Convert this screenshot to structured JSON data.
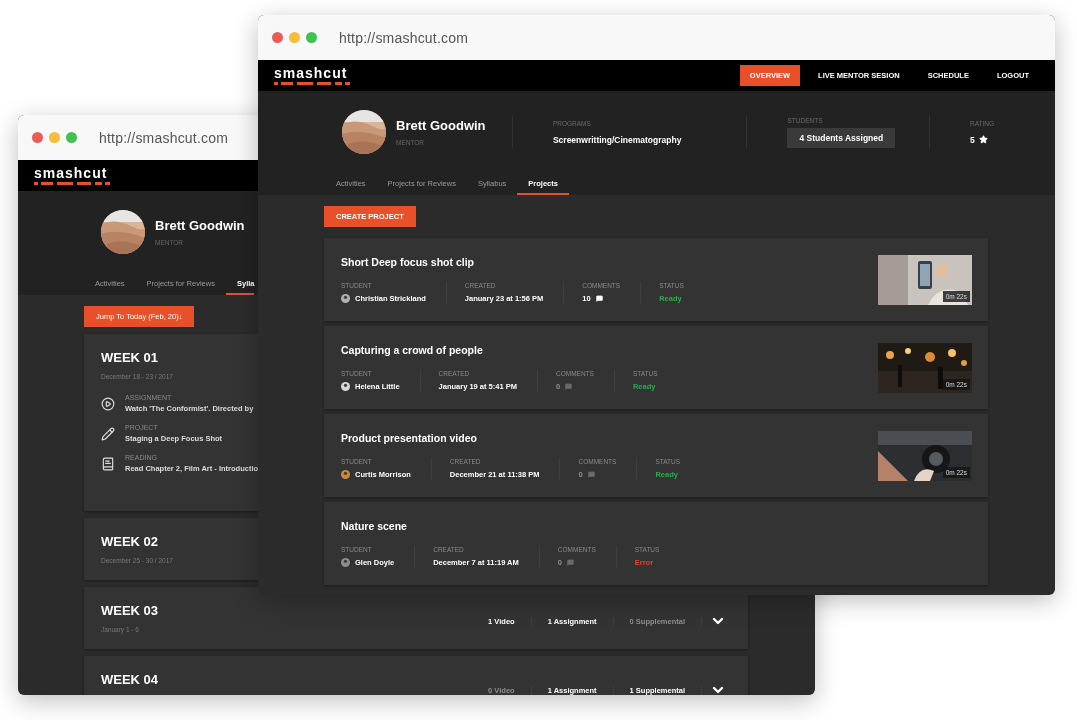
{
  "back_window": {
    "url": "http://smashcut.com",
    "logo": "smashcut",
    "profile": {
      "name": "Brett Goodwin",
      "role": "MENTOR"
    },
    "tabs": [
      {
        "label": "Activities",
        "selected": false
      },
      {
        "label": "Projects for Reviews",
        "selected": false
      },
      {
        "label": "Sylla",
        "selected": true
      }
    ],
    "jump_button": "Jump To Today (Feb, 20)↓",
    "weeks": [
      {
        "title": "WEEK 01",
        "dates": "December 18 - 23 / 2017",
        "items": [
          {
            "kind": "assignment",
            "label": "ASSIGNMENT",
            "text": "Watch 'The Conformist'. Directed by"
          },
          {
            "kind": "project",
            "label": "PROJECT",
            "text": "Staging a Deep Focus Shot"
          },
          {
            "kind": "reading",
            "label": "READING",
            "text": "Read Chapter 2, Film Art - Introductio"
          }
        ]
      },
      {
        "title": "WEEK 02",
        "dates": "December 25 - 30 / 2017"
      },
      {
        "title": "WEEK 03",
        "dates": "January 1 - 6",
        "counts": [
          {
            "text": "1 Video",
            "dimmed": false
          },
          {
            "text": "1 Assignment",
            "dimmed": false
          },
          {
            "text": "0 Supplemental",
            "dimmed": true
          }
        ]
      },
      {
        "title": "WEEK 04",
        "counts": [
          {
            "text": "0 Video",
            "dimmed": true
          },
          {
            "text": "1 Assignment",
            "dimmed": false
          },
          {
            "text": "1 Supplemental",
            "dimmed": false
          }
        ]
      }
    ]
  },
  "front_window": {
    "url": "http://smashcut.com",
    "logo": "smashcut",
    "nav": [
      {
        "label": "OVERVIEW",
        "selected": true
      },
      {
        "label": "LIVE MENTOR SESION",
        "selected": false
      },
      {
        "label": "SCHEDULE",
        "selected": false
      },
      {
        "label": "LOGOUT",
        "selected": false
      }
    ],
    "profile": {
      "name": "Brett Goodwin",
      "role": "MENTOR"
    },
    "stats": [
      {
        "kind": "text",
        "label": "PROGRAMS",
        "value": "Screenwritting/Cinematography"
      },
      {
        "kind": "chip",
        "label": "STUDENTS",
        "value": "4 Students Assigned"
      },
      {
        "kind": "rating",
        "label": "RATING",
        "value": "5"
      }
    ],
    "tabs": [
      {
        "label": "Activities",
        "selected": false
      },
      {
        "label": "Projects for Reviews",
        "selected": false
      },
      {
        "label": "Syllabus",
        "selected": false
      },
      {
        "label": "Projects",
        "selected": true
      }
    ],
    "create_button": "CREATE PROJECT",
    "projects": [
      {
        "title": "Short Deep focus shot clip",
        "labels": {
          "student": "STUDENT",
          "created": "CREATED",
          "comments": "COMMENTS",
          "status": "STATUS"
        },
        "student": "Christian Strickland",
        "created": "January 23 at 1:56 PM",
        "comments": "10",
        "comments_dimmed": false,
        "status": "Ready",
        "color": "#2fa84f",
        "thumbnail": {
          "kind": "picture",
          "duration": "0m 22s"
        }
      },
      {
        "title": "Capturing a crowd of people",
        "labels": {
          "student": "STUDENT",
          "created": "CREATED",
          "comments": "COMMENTS",
          "status": "STATUS"
        },
        "student": "Helena Little",
        "created": "January 19 at 5:41 PM",
        "comments": "0",
        "comments_dimmed": true,
        "status": "Ready",
        "color": "#2fa84f",
        "thumbnail": {
          "kind": "picture",
          "duration": "0m 22s"
        }
      },
      {
        "title": "Product presentation video",
        "labels": {
          "student": "STUDENT",
          "created": "CREATED",
          "comments": "COMMENTS",
          "status": "STATUS"
        },
        "student": "Curtis Morrison",
        "created": "December 21 at 11:38 PM",
        "comments": "0",
        "comments_dimmed": true,
        "status": "Ready",
        "color": "#2fa84f",
        "thumbnail": {
          "kind": "picture",
          "duration": "0m 22s"
        }
      },
      {
        "title": "Nature scene",
        "labels": {
          "student": "STUDENT",
          "created": "CREATED",
          "comments": "COMMENTS",
          "status": "STATUS"
        },
        "student": "Glen Doyle",
        "created": "December 7 at 11:19 AM",
        "comments": "0",
        "comments_dimmed": true,
        "status": "Error",
        "color": "#e0442d"
      }
    ]
  }
}
